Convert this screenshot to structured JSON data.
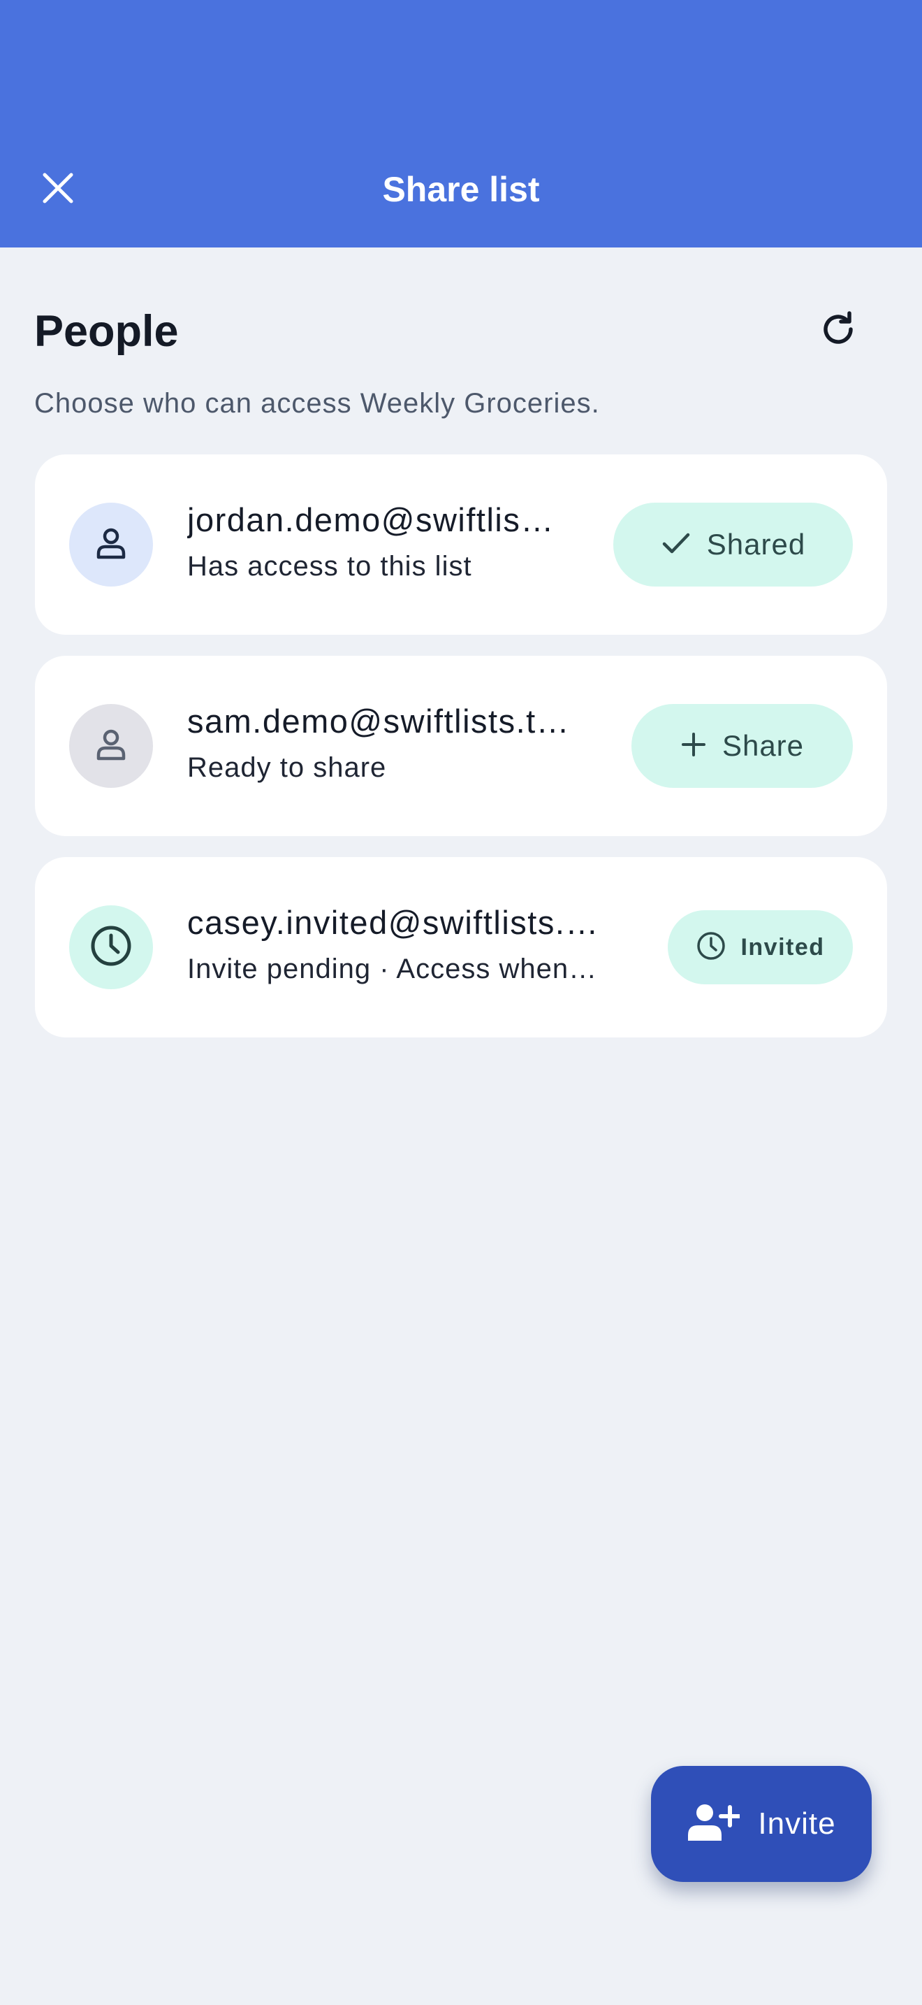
{
  "header": {
    "title": "Share list",
    "close_icon": "close-icon",
    "background": "#4a72de"
  },
  "section": {
    "title": "People",
    "refresh_icon": "refresh-icon",
    "subtitle": "Choose who can access Weekly Groceries."
  },
  "people": [
    {
      "email": "jordan.demo@swiftlis…",
      "status": "Has access to this list",
      "avatar_icon": "person-icon",
      "action_icon": "check-icon",
      "action_label": "Shared"
    },
    {
      "email": "sam.demo@swiftlists.t…",
      "status": "Ready to share",
      "avatar_icon": "person-icon",
      "action_icon": "plus-icon",
      "action_label": "Share"
    },
    {
      "email": "casey.invited@swiftlists.…",
      "status": "Invite pending · Access when…",
      "avatar_icon": "clock-icon",
      "action_icon": "clock-icon",
      "action_label": "Invited"
    }
  ],
  "fab": {
    "label": "Invite",
    "icon": "add-person-icon"
  },
  "colors": {
    "accent": "#4a72de",
    "fab": "#2f4fb8",
    "pill": "#d3f7ee",
    "avatar_shared": "#dde7fb",
    "avatar_ready": "#e2e2e8",
    "avatar_invited": "#d3f7ee"
  }
}
